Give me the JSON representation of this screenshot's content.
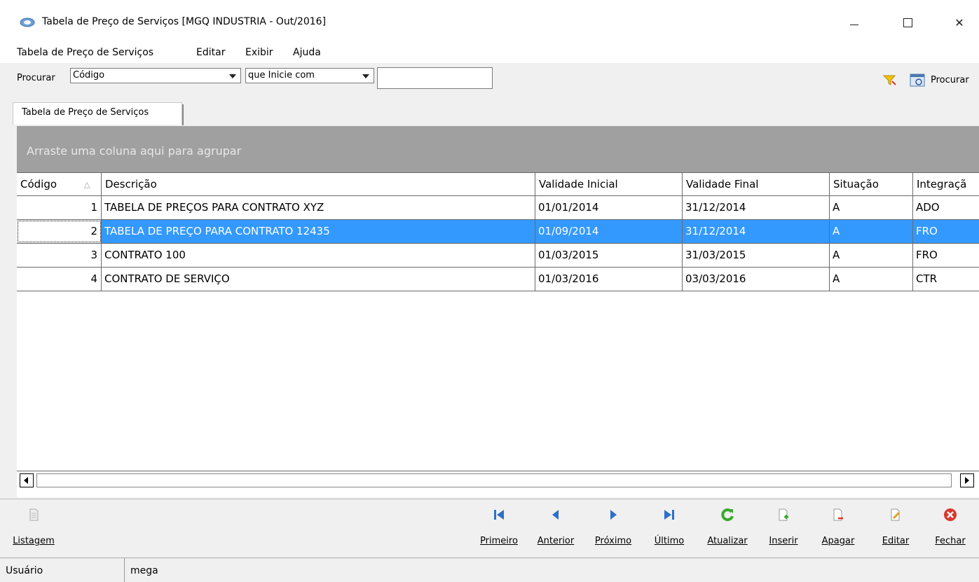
{
  "window": {
    "title": "Tabela de Preço de Serviços [MGQ INDUSTRIA - Out/2016]"
  },
  "menu": [
    "Tabela de Preço de Serviços",
    "Editar",
    "Exibir",
    "Ajuda"
  ],
  "search": {
    "label": "Procurar",
    "field": "Código",
    "operator": "que Inicie com",
    "value": "",
    "button": "Procurar"
  },
  "tab": "Tabela de Preço de Serviços",
  "grid": {
    "group_hint": "Arraste uma coluna aqui para agrupar",
    "columns": [
      "Código",
      "Descrição",
      "Validade Inicial",
      "Validade Final",
      "Situação",
      "Integraçã"
    ],
    "rows": [
      [
        "1",
        "TABELA DE PREÇOS PARA CONTRATO XYZ",
        "01/01/2014",
        "31/12/2014",
        "A",
        "ADO"
      ],
      [
        "2",
        "TABELA DE PREÇO PARA CONTRATO 12435",
        "01/09/2014",
        "31/12/2014",
        "A",
        "FRO"
      ],
      [
        "3",
        "CONTRATO 100",
        "01/03/2015",
        "31/03/2015",
        "A",
        "FRO"
      ],
      [
        "4",
        "CONTRATO DE SERVIÇO",
        "01/03/2016",
        "03/03/2016",
        "A",
        "CTR"
      ]
    ],
    "selected_row": 2
  },
  "actions": {
    "listagem": "Listagem",
    "primeiro": "Primeiro",
    "anterior": "Anterior",
    "proximo": "Próximo",
    "ultimo": "Último",
    "atualizar": "Atualizar",
    "inserir": "Inserir",
    "apagar": "Apagar",
    "editar": "Editar",
    "fechar": "Fechar"
  },
  "status": {
    "label": "Usuário",
    "value": "mega"
  },
  "colors": {
    "selection": "#3399ff",
    "group_area": "#a0a0a0",
    "nav_blue": "#2e6fc9",
    "refresh_green": "#3aa82e",
    "close_red": "#d9382c"
  }
}
